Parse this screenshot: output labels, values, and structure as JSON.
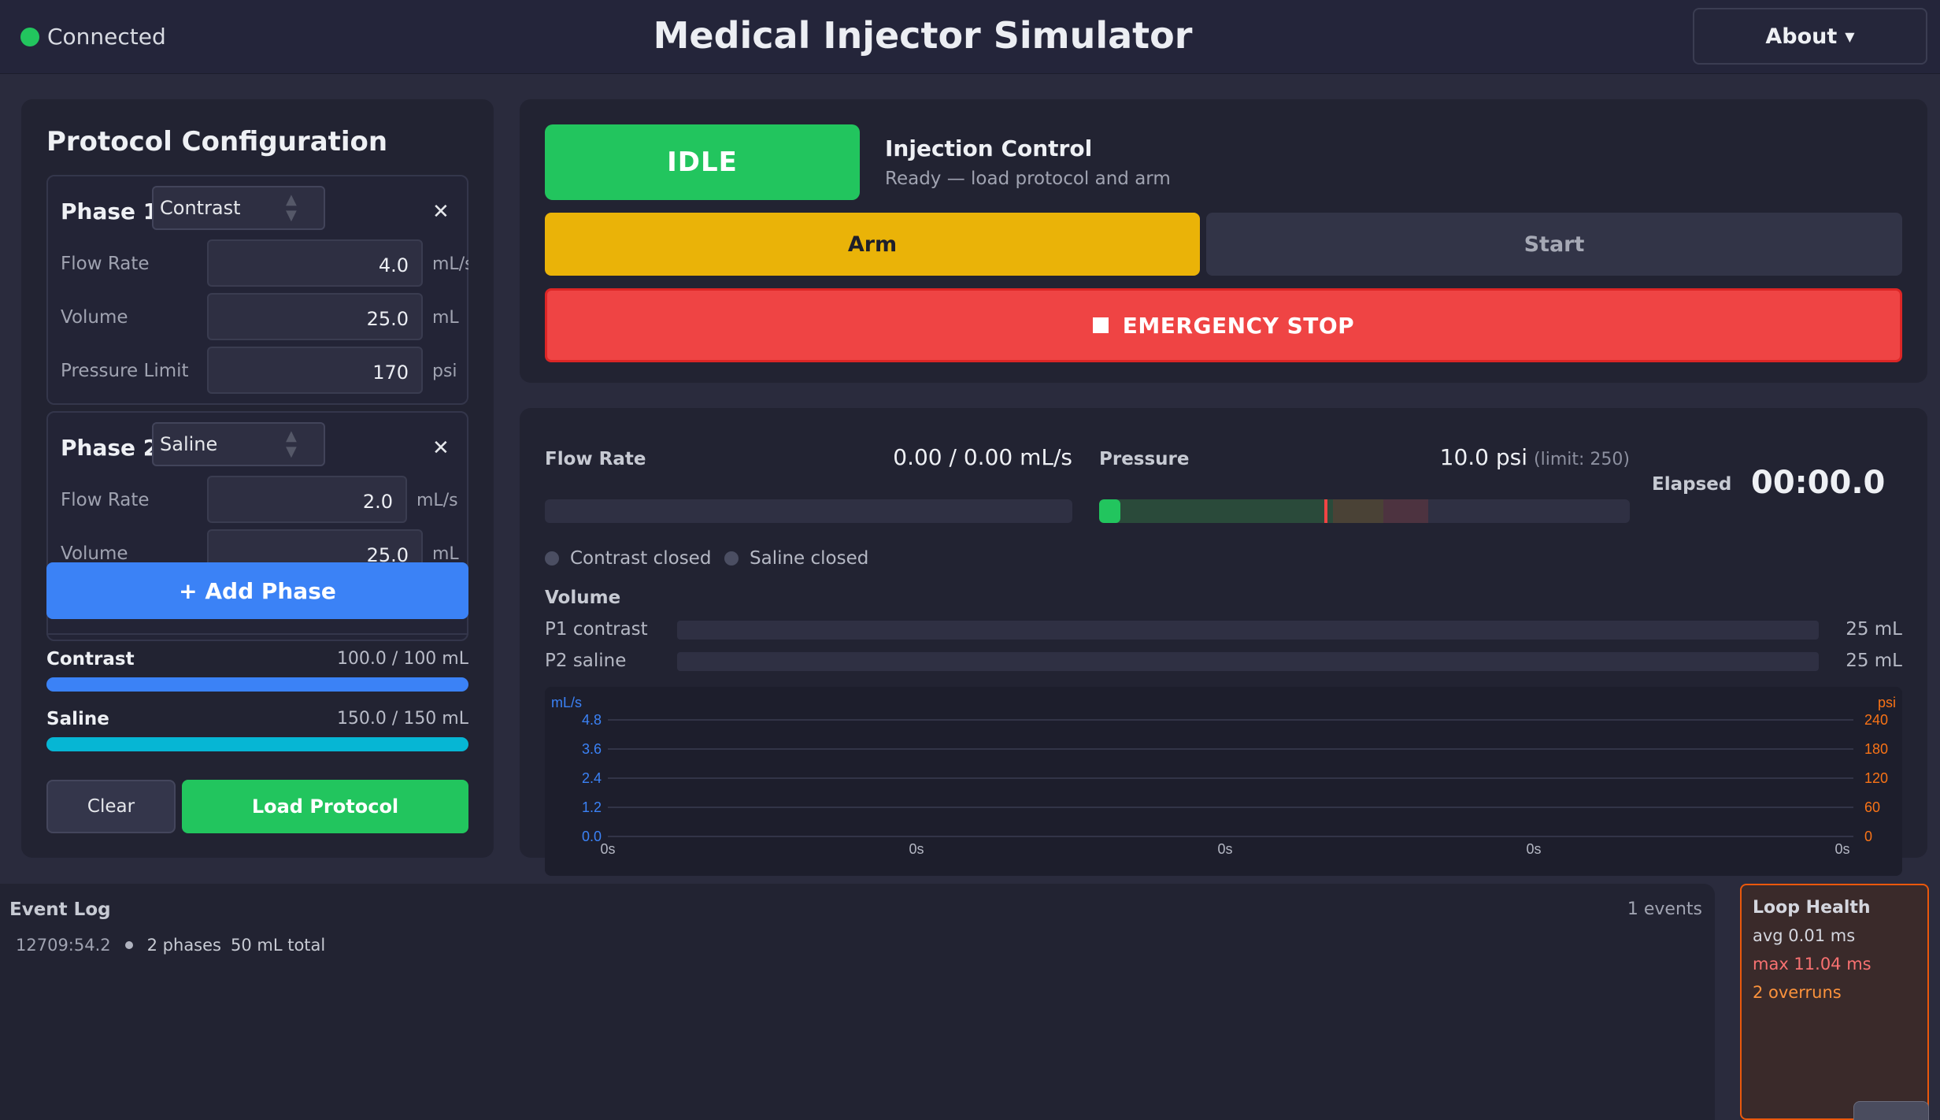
{
  "header": {
    "status": "Connected",
    "title": "Medical Injector Simulator",
    "about_label": "About",
    "status_color": "#22c55e"
  },
  "protocol": {
    "title": "Protocol Configuration",
    "phases": [
      {
        "title": "Phase 1",
        "type": "Contrast",
        "fields": [
          {
            "label": "Flow Rate",
            "value": "4.0",
            "unit": "mL/s"
          },
          {
            "label": "Volume",
            "value": "25.0",
            "unit": "mL"
          },
          {
            "label": "Pressure Limit",
            "value": "170",
            "unit": "psi"
          }
        ]
      },
      {
        "title": "Phase 2",
        "type": "Saline",
        "fields": [
          {
            "label": "Flow Rate",
            "value": "2.0",
            "unit": "mL/s"
          },
          {
            "label": "Volume",
            "value": "25.0",
            "unit": "mL"
          }
        ]
      }
    ],
    "add_phase_label": "+ Add Phase",
    "reservoirs": [
      {
        "name": "Contrast",
        "value": "100.0 / 100 mL",
        "fill": 1.0,
        "color": "#3b82f6"
      },
      {
        "name": "Saline",
        "value": "150.0 / 150 mL",
        "fill": 1.0,
        "color": "#06b6d4"
      }
    ],
    "clear_label": "Clear",
    "load_label": "Load Protocol"
  },
  "control": {
    "state": "IDLE",
    "title": "Injection Control",
    "subtitle": "Ready — load protocol and arm",
    "arm_label": "Arm",
    "start_label": "Start",
    "estop_label": "EMERGENCY STOP"
  },
  "monitor": {
    "flow_label": "Flow Rate",
    "flow_value": "0.00 / 0.00 mL/s",
    "flow_fill": 0,
    "pressure_label": "Pressure",
    "pressure_value": "10.0 psi",
    "pressure_limit": "(limit: 250)",
    "pressure_current_psi": 10,
    "pressure_limit_psi": 250,
    "pressure_marker_psi": 170,
    "elapsed_label": "Elapsed",
    "elapsed_value": "00:00.0",
    "valves": [
      {
        "label": "Contrast closed"
      },
      {
        "label": "Saline closed"
      }
    ],
    "volume_title": "Volume",
    "volumes": [
      {
        "name": "P1 contrast",
        "amount": "25 mL",
        "fill": 0
      },
      {
        "name": "P2 saline",
        "amount": "25 mL",
        "fill": 0
      }
    ]
  },
  "chart_data": {
    "type": "line",
    "left_unit": "mL/s",
    "right_unit": "psi",
    "y_left_ticks": [
      "4.8",
      "3.6",
      "2.4",
      "1.2",
      "0.0"
    ],
    "y_right_ticks": [
      "240",
      "180",
      "120",
      "60",
      "0"
    ],
    "x_ticks": [
      "0s",
      "0s",
      "0s",
      "0s",
      "0s"
    ],
    "ylim_left": [
      0,
      4.8
    ],
    "ylim_right": [
      0,
      240
    ],
    "grid": true,
    "series": []
  },
  "event_log": {
    "title": "Event Log",
    "count": "1 events",
    "events": [
      {
        "time": "12709:54.2",
        "message": "2 phases",
        "detail": "50 mL total"
      }
    ]
  },
  "loop_health": {
    "title": "Loop Health",
    "avg": "avg 0.01 ms",
    "max": "max 11.04 ms",
    "overruns": "2 overruns"
  }
}
